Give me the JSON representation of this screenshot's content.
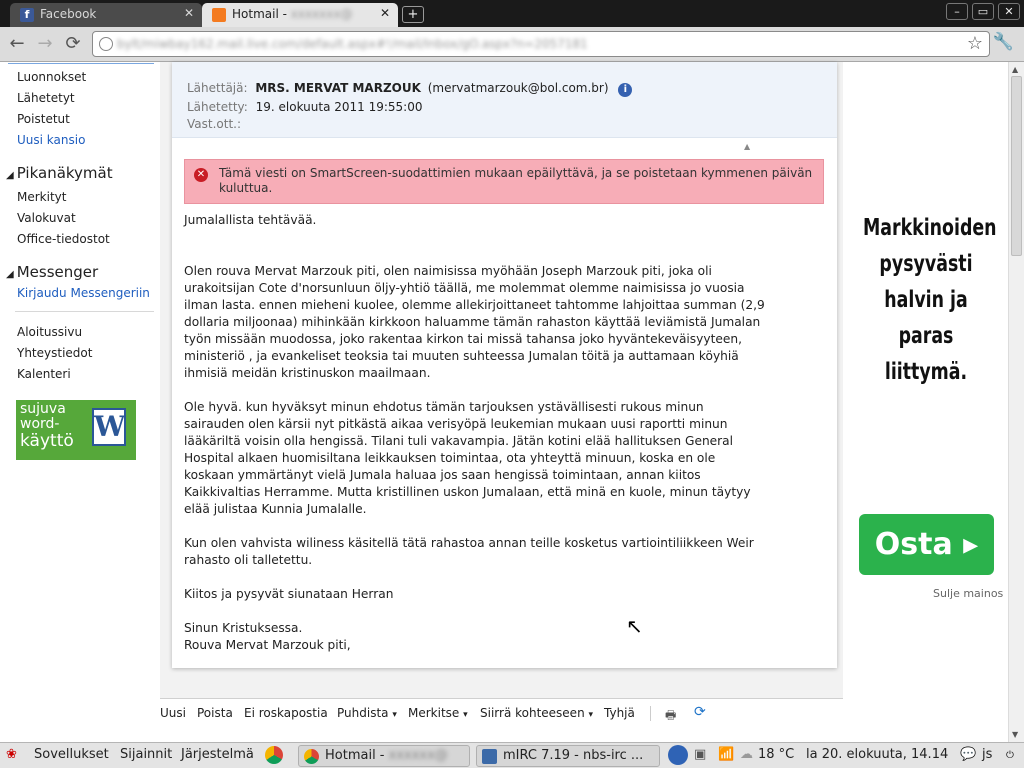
{
  "browser": {
    "tabs": [
      {
        "label": "Facebook",
        "icon": "facebook-icon",
        "active": false
      },
      {
        "label": "Hotmail - ",
        "icon": "hotmail-icon",
        "active": true
      }
    ],
    "new_tab": "+",
    "window_controls": [
      "–",
      "▭",
      "✕"
    ],
    "url": "bylt/miwbay162.mail.live.com/default.aspx#!/mail/Inbox/gO.aspx?n=2057181",
    "colors": {
      "tabstrip": "#1a1a1a",
      "toolbar": "#dcdcdc"
    }
  },
  "sidebar": {
    "folders": [
      {
        "label": "Luonnokset"
      },
      {
        "label": "Lähetetyt"
      },
      {
        "label": "Poistetut"
      },
      {
        "label": "Uusi kansio"
      }
    ],
    "quickviews_title": "Pikanäkymät",
    "quickviews": [
      {
        "label": "Merkityt"
      },
      {
        "label": "Valokuvat"
      },
      {
        "label": "Office-tiedostot"
      }
    ],
    "messenger_title": "Messenger",
    "messenger_link": "Kirjaudu Messengeriin",
    "links": [
      {
        "label": "Aloitussivu"
      },
      {
        "label": "Yhteystiedot"
      },
      {
        "label": "Kalenteri"
      }
    ],
    "word_ad": {
      "line1": "sujuva",
      "line2": "word-",
      "line3": "käyttö",
      "logo": "W"
    }
  },
  "message": {
    "from_label": "Lähettäjä:",
    "from_name": "MRS. MERVAT MARZOUK",
    "from_email": "(mervatmarzouk@bol.com.br)",
    "sent_label": "Lähetetty:",
    "sent_value": "19. elokuuta 2011 19:55:00",
    "to_label": "Vast.ott.:",
    "warning": "Tämä viesti on SmartScreen-suodattimien mukaan epäilyttävä, ja se poistetaan kymmenen päivän kuluttua.",
    "body": "Jumalallista tehtävää.\n\n\nOlen rouva Mervat Marzouk piti, olen naimisissa myöhään Joseph Marzouk piti, joka oli\nurakoitsijan Cote d'norsunluun öljy-yhtiö täällä, me molemmat olemme naimisissa jo vuosia\nilman lasta. ennen mieheni kuolee, olemme allekirjoittaneet tahtomme lahjoittaa summan (2,9\ndollaria miljoonaa) mihinkään kirkkoon haluamme tämän rahaston käyttää leviämistä Jumalan\ntyön missään muodossa, joko rakentaa kirkon tai missä tahansa joko hyväntekeväisyyteen,\nministeriö , ja evankeliset teoksia tai muuten suhteessa Jumalan töitä ja auttamaan köyhiä\nihmisiä meidän kristinuskon maailmaan.\n\nOle hyvä. kun hyväksyt minun ehdotus tämän tarjouksen ystävällisesti rukous minun\nsairauden olen kärsii nyt pitkästä aikaa verisyöpä leukemian mukaan uusi raportti minun\nlääkäriltä voisin olla hengissä. Tilani tuli vakavampia. Jätän kotini elää hallituksen General\nHospital alkaen huomisiltana leikkauksen toimintaa, ota yhteyttä minuun, koska en ole\nkoskaan ymmärtänyt vielä Jumala haluaa jos saan hengissä toimintaan, annan kiitos\nKaikkivaltias Herramme. Mutta kristillinen uskon Jumalaan, että minä en kuole, minun täytyy\nelää julistaa Kunnia Jumalalle.\n\nKun olen vahvista wiliness käsitellä tätä rahastoa annan teille kosketus vartiointiliikkeen Weir\nrahasto oli talletettu.\n\nKiitos ja pysyvät siunataan Herran\n\nSinun Kristuksessa.\nRouva Mervat Marzouk piti,"
  },
  "commands": {
    "new": "Uusi",
    "delete": "Poista",
    "not_junk": "Ei roskapostia",
    "sweep": "Puhdista",
    "mark": "Merkitse",
    "move": "Siirrä kohteeseen",
    "empty": "Tyhjä",
    "dropdown": "▾"
  },
  "ad": {
    "headline": "Markkinoiden pysyvästi halvin ja paras liittymä.",
    "button": "Osta ▸",
    "close": "Sulje mainos",
    "colors": {
      "button": "#2bb24c"
    }
  },
  "taskbar": {
    "menus": [
      "Sovellukset",
      "Sijainnit",
      "Järjestelmä"
    ],
    "windows": [
      {
        "label": "Hotmail - ",
        "icon": "chrome-icon"
      },
      {
        "label": "mIRC 7.19 - nbs-irc ...",
        "icon": "mirc-icon"
      }
    ],
    "temperature": "18 °C",
    "clock": "la 20. elokuuta, 14.14",
    "user": "js"
  }
}
